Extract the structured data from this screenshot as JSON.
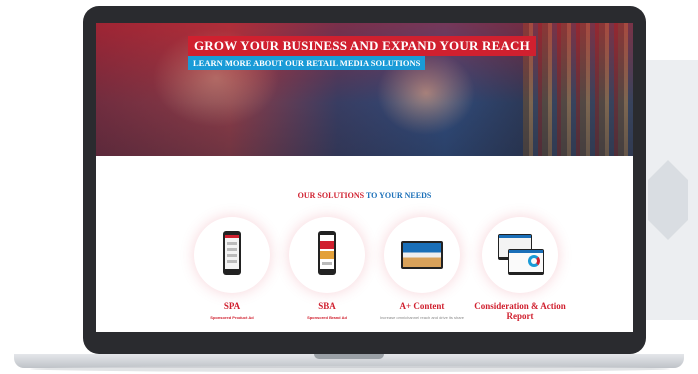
{
  "hero": {
    "title": "GROW YOUR BUSINESS AND EXPAND YOUR REACH",
    "subtitle": "LEARN MORE ABOUT OUR RETAIL MEDIA SOLUTIONS"
  },
  "solutions": {
    "heading_part1": "OUR SOLUTIONS",
    "heading_part2": " TO YOUR NEEDS",
    "items": [
      {
        "name": "SPA",
        "desc": "Sponsored Product Ad",
        "icon": "phone-product-list-icon"
      },
      {
        "name": "SBA",
        "desc": "Sponsored Brand Ad",
        "icon": "phone-brand-banner-icon"
      },
      {
        "name": "A+ Content",
        "desc": "Increase omnichannel reach and drive its share",
        "icon": "tablet-content-icon"
      },
      {
        "name": "Consideration & Action Report",
        "desc": "",
        "icon": "dashboard-report-icon"
      }
    ]
  },
  "colors": {
    "brand_red": "#d0202f",
    "accent_blue": "#1a9bd7",
    "heading_blue": "#1a6fb8"
  }
}
